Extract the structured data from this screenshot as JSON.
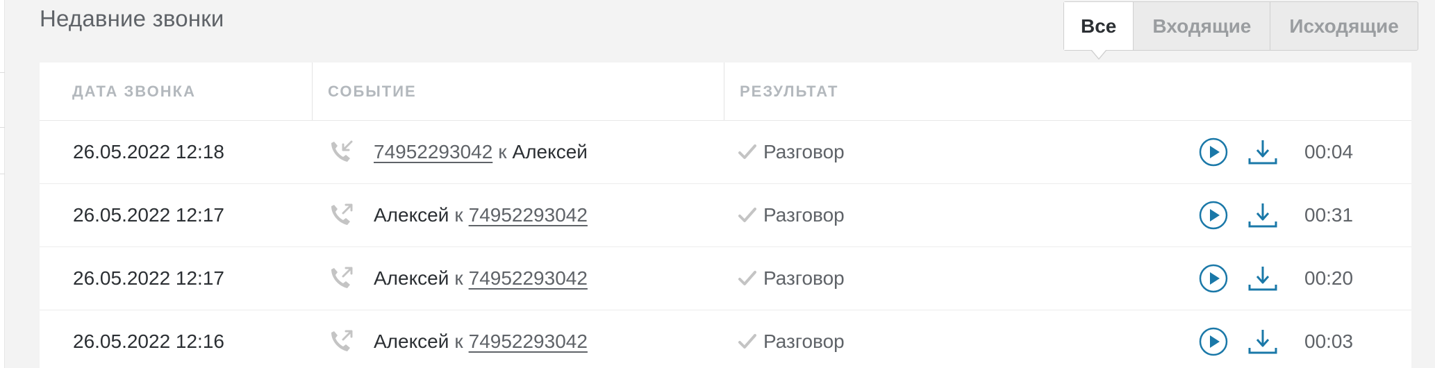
{
  "title": "Недавние звонки",
  "tabs": [
    {
      "label": "Все",
      "active": true
    },
    {
      "label": "Входящие",
      "active": false
    },
    {
      "label": "Исходящие",
      "active": false
    }
  ],
  "columns": [
    "ДАТА ЗВОНКА",
    "СОБЫТИЕ",
    "РЕЗУЛЬТАТ"
  ],
  "connector": "к",
  "rows": [
    {
      "date": "26.05.2022 12:18",
      "direction": "incoming",
      "from": "74952293042",
      "to": "Алексей",
      "result": "Разговор",
      "duration": "00:04"
    },
    {
      "date": "26.05.2022 12:17",
      "direction": "outgoing",
      "from": "Алексей",
      "to": "74952293042",
      "result": "Разговор",
      "duration": "00:31"
    },
    {
      "date": "26.05.2022 12:17",
      "direction": "outgoing",
      "from": "Алексей",
      "to": "74952293042",
      "result": "Разговор",
      "duration": "00:20"
    },
    {
      "date": "26.05.2022 12:16",
      "direction": "outgoing",
      "from": "Алексей",
      "to": "74952293042",
      "result": "Разговор",
      "duration": "00:03"
    }
  ],
  "icons": {
    "incoming": "phone-incoming-icon",
    "outgoing": "phone-outgoing-icon",
    "result": "check-icon",
    "play": "play-icon",
    "download": "download-icon"
  },
  "colors": {
    "accent": "#1a78a8",
    "icon_gray": "#c4c4c4"
  }
}
